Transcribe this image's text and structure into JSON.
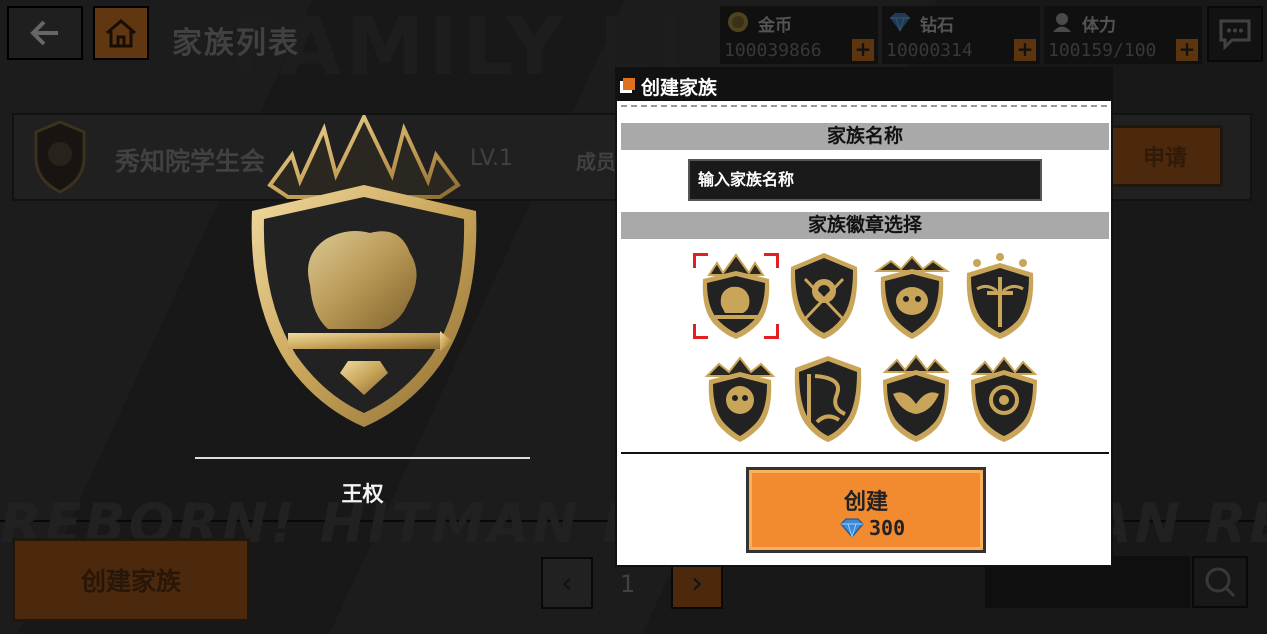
{
  "header": {
    "title": "家族列表",
    "bg_word": "FAMILY LI"
  },
  "resources": [
    {
      "label": "金币",
      "value": "100039866",
      "icon": "coin-icon"
    },
    {
      "label": "钻石",
      "value": "10000314",
      "icon": "diamond-icon"
    },
    {
      "label": "体力",
      "value": "100159/100",
      "icon": "stamina-icon"
    }
  ],
  "family_row": {
    "name": "秀知院学生会",
    "level": "LV.1",
    "members_label": "成员",
    "apply_label": "申请"
  },
  "banner_text": "REBORN! HITMAN REBORN! HITMAN REBORN!",
  "bottom": {
    "create_family_label": "创建家族",
    "page_number": "1"
  },
  "preview": {
    "emblem_name": "王权"
  },
  "dialog": {
    "title": "创建家族",
    "name_section": "家族名称",
    "name_placeholder": "输入家族名称",
    "badge_section": "家族徽章选择",
    "create_label": "创建",
    "cost": "300"
  },
  "badges": [
    "lion-crest",
    "samurai-crest",
    "dragon-mask-crest",
    "sword-cross-crest",
    "guardian-lion-crest",
    "dragon-crest",
    "bird-crest",
    "sun-crest"
  ],
  "colors": {
    "accent": "#f28a30",
    "gold": "#c9a85a",
    "selection": "#e02020"
  }
}
